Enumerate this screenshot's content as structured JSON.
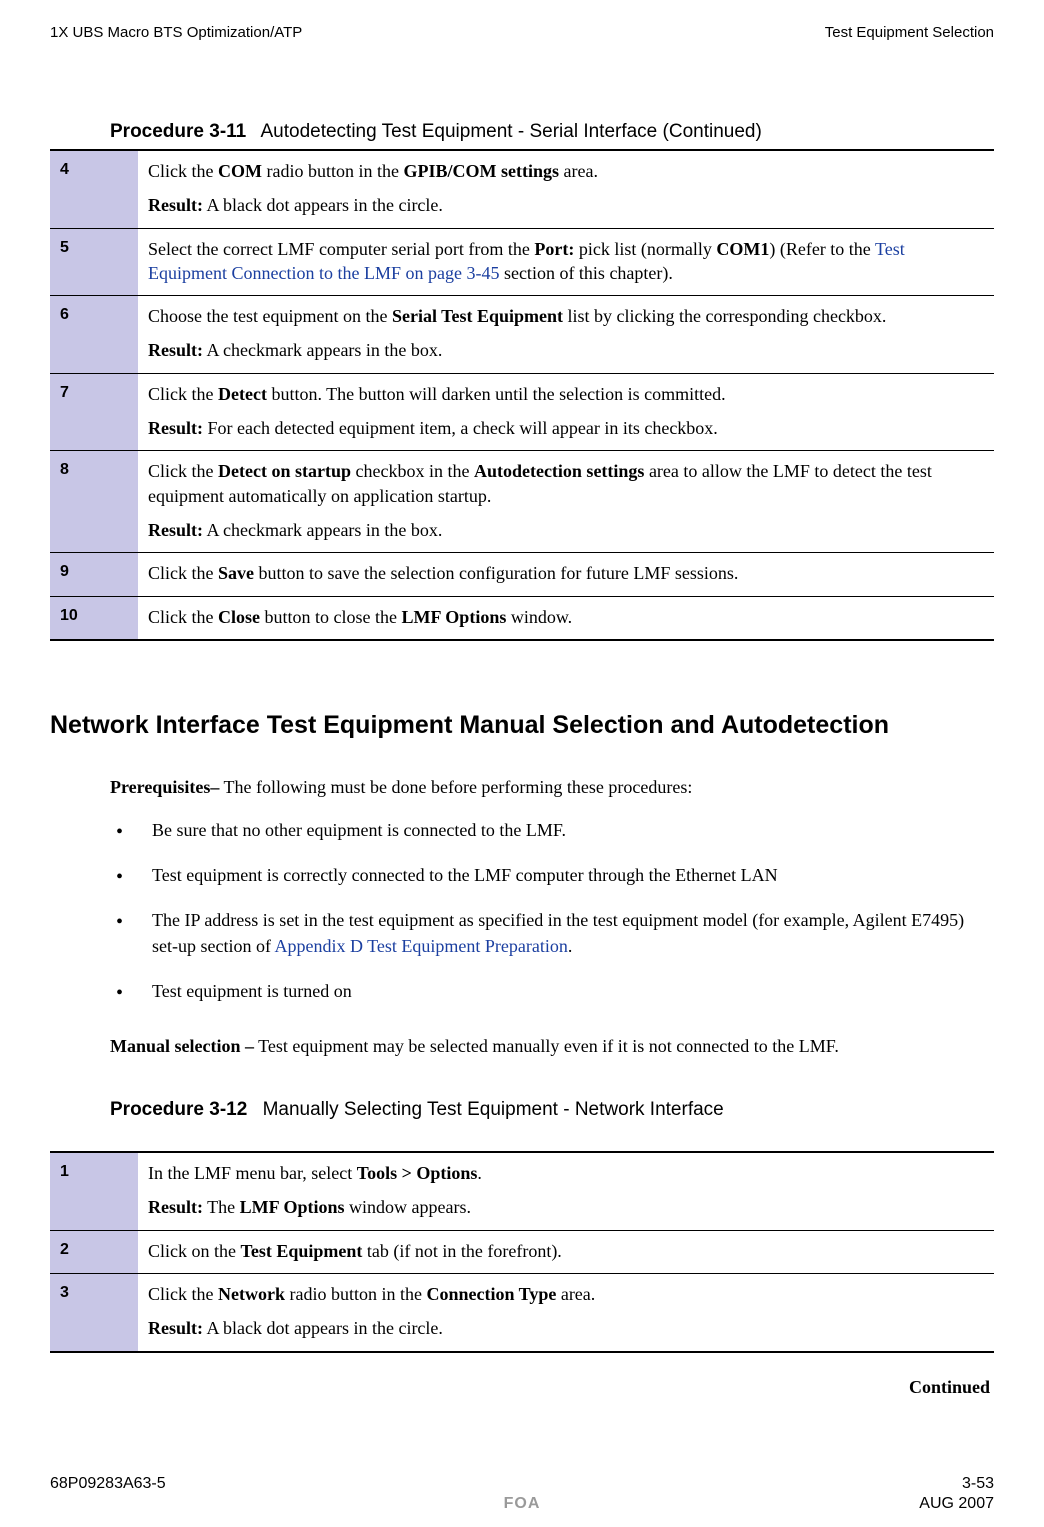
{
  "header": {
    "left": "1X UBS Macro BTS Optimization/ATP",
    "right": "Test Equipment Selection"
  },
  "procedure311": {
    "label": "Procedure 3-11",
    "title": "Autodetecting Test Equipment - Serial Interface (Continued)",
    "rows": [
      {
        "num": "4",
        "text_pre": "Click the ",
        "b1": "COM",
        "text_mid": " radio button in the ",
        "b2": "GPIB/COM settings",
        "text_post": " area.",
        "result_label": "Result:",
        "result_text": " A black dot appears in the circle."
      },
      {
        "num": "5",
        "text_pre": "Select the correct LMF computer serial port from the ",
        "b1": "Port:",
        "text_mid": " pick list (normally ",
        "b2": "COM1",
        "text_post1": ") (Refer to the ",
        "link": "Test Equipment Connection to the LMF on page 3-45",
        "text_post2": " section of this chapter)."
      },
      {
        "num": "6",
        "text_pre": "Choose the test equipment on the ",
        "b1": "Serial Test Equipment",
        "text_post": " list by clicking the corresponding checkbox.",
        "result_label": "Result:",
        "result_text": " A checkmark appears in the box."
      },
      {
        "num": "7",
        "text_pre": "Click the ",
        "b1": "Detect",
        "text_post": " button. The button will darken until the selection is committed.",
        "result_label": "Result:",
        "result_text": " For each detected equipment item, a check will appear in its checkbox."
      },
      {
        "num": "8",
        "text_pre": "Click the ",
        "b1": "Detect on startup",
        "text_mid": " checkbox in the ",
        "b2": "Autodetection settings",
        "text_post": " area to allow the LMF to detect the test equipment automatically on application startup.",
        "result_label": "Result:",
        "result_text": " A checkmark appears in the box."
      },
      {
        "num": "9",
        "text_pre": "Click the ",
        "b1": "Save",
        "text_post": " button to save the selection configuration for future LMF sessions."
      },
      {
        "num": "10",
        "text_pre": "Click the ",
        "b1": "Close",
        "text_mid": " button to close the ",
        "b2": "LMF Options",
        "text_post": " window."
      }
    ]
  },
  "section_heading": "Network Interface Test Equipment Manual Selection and Autodetection",
  "prereq": {
    "label": "Prerequisites–",
    "intro": " The following must be done before performing these procedures:",
    "bullets": [
      {
        "text": "Be sure that no other equipment is connected to the LMF."
      },
      {
        "text": "Test equipment is correctly connected to the LMF computer through the Ethernet LAN"
      },
      {
        "text_pre": "The IP address is set in the test equipment as specified in the test equipment model (for example, Agilent E7495) set-up section of ",
        "link": "Appendix D Test Equipment Preparation",
        "text_post": "."
      },
      {
        "text": "Test equipment is turned on"
      }
    ]
  },
  "manual_selection": {
    "label": "Manual selection –",
    "text": " Test equipment may be selected manually even if it is not connected to the LMF."
  },
  "procedure312": {
    "label": "Procedure 3-12",
    "title": "Manually Selecting Test Equipment - Network Interface",
    "rows": [
      {
        "num": "1",
        "text_pre": "In the LMF menu bar, select ",
        "b1": "Tools > Options",
        "text_post": ".",
        "result_label": "Result:",
        "result_pre": " The ",
        "result_b": "LMF Options",
        "result_post": " window appears."
      },
      {
        "num": "2",
        "text_pre": "Click on the ",
        "b1": "Test Equipment",
        "text_post": " tab (if not in the forefront)."
      },
      {
        "num": "3",
        "text_pre": "Click the ",
        "b1": "Network",
        "text_mid": " radio button in the ",
        "b2": "Connection Type",
        "text_post": " area.",
        "result_label": "Result:",
        "result_text": " A black dot appears in the circle."
      }
    ]
  },
  "continued": "Continued",
  "footer": {
    "doc_id": "68P09283A63-5",
    "page": "3-53",
    "foa": "FOA",
    "date": "AUG 2007"
  }
}
